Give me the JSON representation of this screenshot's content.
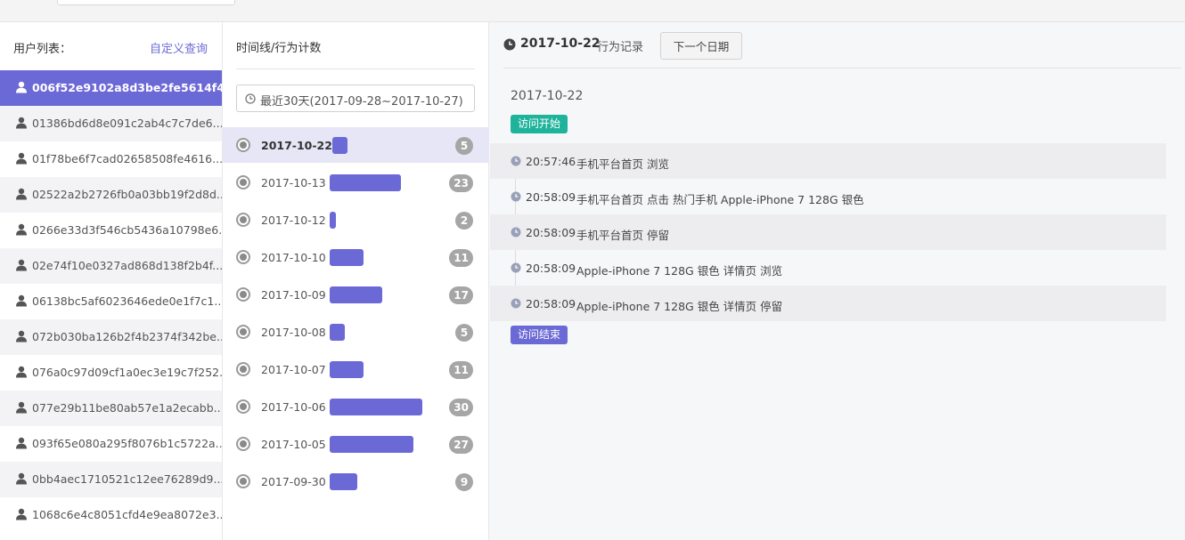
{
  "colors": {
    "accent": "#6b69d6",
    "start_tag": "#1fb39b",
    "badge": "#a6a6a6"
  },
  "users": {
    "title": "用户列表：",
    "custom_query": "自定义查询",
    "selected_index": 0,
    "items": [
      {
        "id": "006f52e9102a8d3be2fe5614f4..."
      },
      {
        "id": "01386bd6d8e091c2ab4c7c7de6..."
      },
      {
        "id": "01f78be6f7cad02658508fe4616..."
      },
      {
        "id": "02522a2b2726fb0a03bb19f2d8d..."
      },
      {
        "id": "0266e33d3f546cb5436a10798e6..."
      },
      {
        "id": "02e74f10e0327ad868d138f2b4f..."
      },
      {
        "id": "06138bc5af6023646ede0e1f7c1..."
      },
      {
        "id": "072b030ba126b2f4b2374f342be..."
      },
      {
        "id": "076a0c97d09cf1a0ec3e19c7f252..."
      },
      {
        "id": "077e29b11be80ab57e1a2ecabb..."
      },
      {
        "id": "093f65e080a295f8076b1c5722a..."
      },
      {
        "id": "0bb4aec1710521c12ee76289d9..."
      },
      {
        "id": "1068c6e4c8051cfd4e9ea8072e3..."
      }
    ]
  },
  "timeline": {
    "title": "时间线/行为计数",
    "range_label": "最近30天(2017-09-28~2017-10-27)",
    "max_count": 30,
    "selected_date": "2017-10-22",
    "days": [
      {
        "date": "2017-10-22",
        "count": 5
      },
      {
        "date": "2017-10-13",
        "count": 23
      },
      {
        "date": "2017-10-12",
        "count": 2
      },
      {
        "date": "2017-10-10",
        "count": 11
      },
      {
        "date": "2017-10-09",
        "count": 17
      },
      {
        "date": "2017-10-08",
        "count": 5
      },
      {
        "date": "2017-10-07",
        "count": 11
      },
      {
        "date": "2017-10-06",
        "count": 30
      },
      {
        "date": "2017-10-05",
        "count": 27
      },
      {
        "date": "2017-09-30",
        "count": 9
      }
    ]
  },
  "detail": {
    "date": "2017-10-22",
    "title": "行为记录",
    "next_button": "下一个日期",
    "day_label": "2017-10-22",
    "start_tag": "访问开始",
    "end_tag": "访问结束",
    "events": [
      {
        "time": "20:57:46",
        "desc": "手机平台首页 浏览"
      },
      {
        "time": "20:58:09",
        "desc": "手机平台首页 点击 热门手机 Apple-iPhone 7 128G 银色"
      },
      {
        "time": "20:58:09",
        "desc": "手机平台首页 停留"
      },
      {
        "time": "20:58:09",
        "desc": "Apple-iPhone 7 128G 银色 详情页 浏览"
      },
      {
        "time": "20:58:09",
        "desc": "Apple-iPhone 7 128G 银色 详情页 停留"
      }
    ]
  }
}
